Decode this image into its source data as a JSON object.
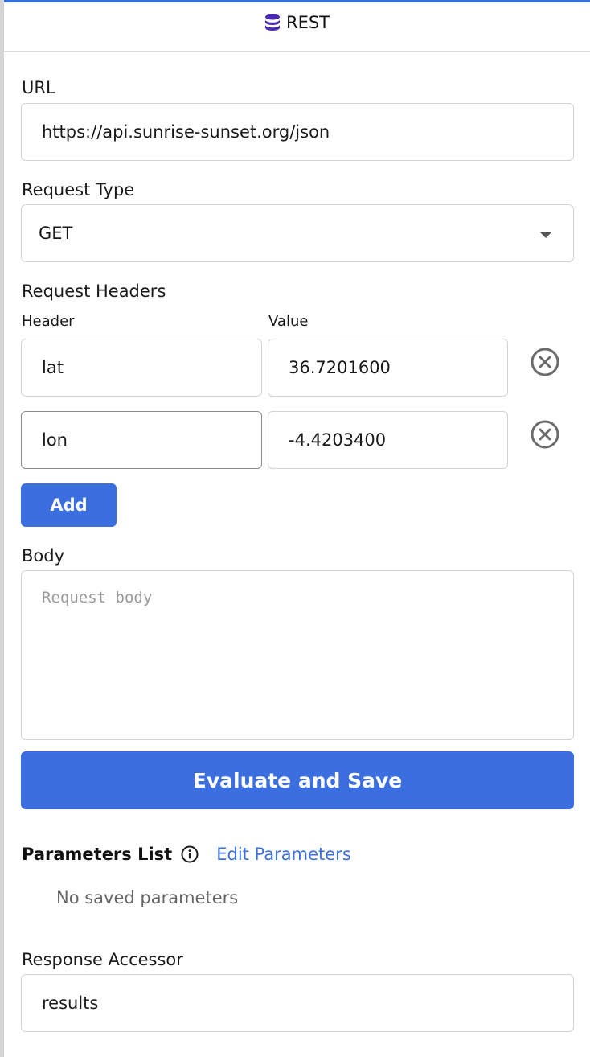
{
  "header": {
    "icon": "database-icon",
    "title": "REST"
  },
  "url": {
    "label": "URL",
    "value": "https://api.sunrise-sunset.org/json"
  },
  "request_type": {
    "label": "Request Type",
    "selected": "GET"
  },
  "request_headers": {
    "label": "Request Headers",
    "header_col": "Header",
    "value_col": "Value",
    "rows": [
      {
        "key": "lat",
        "value": "36.7201600"
      },
      {
        "key": "lon",
        "value": "-4.4203400"
      }
    ],
    "add_label": "Add"
  },
  "body": {
    "label": "Body",
    "placeholder": "Request body"
  },
  "evaluate_label": "Evaluate and Save",
  "parameters": {
    "title": "Parameters List",
    "edit_label": "Edit Parameters",
    "empty_text": "No saved parameters"
  },
  "response_accessor": {
    "label": "Response Accessor",
    "value": "results"
  },
  "colors": {
    "accent": "#3b6fe0",
    "header_icon": "#4a2ab0"
  }
}
